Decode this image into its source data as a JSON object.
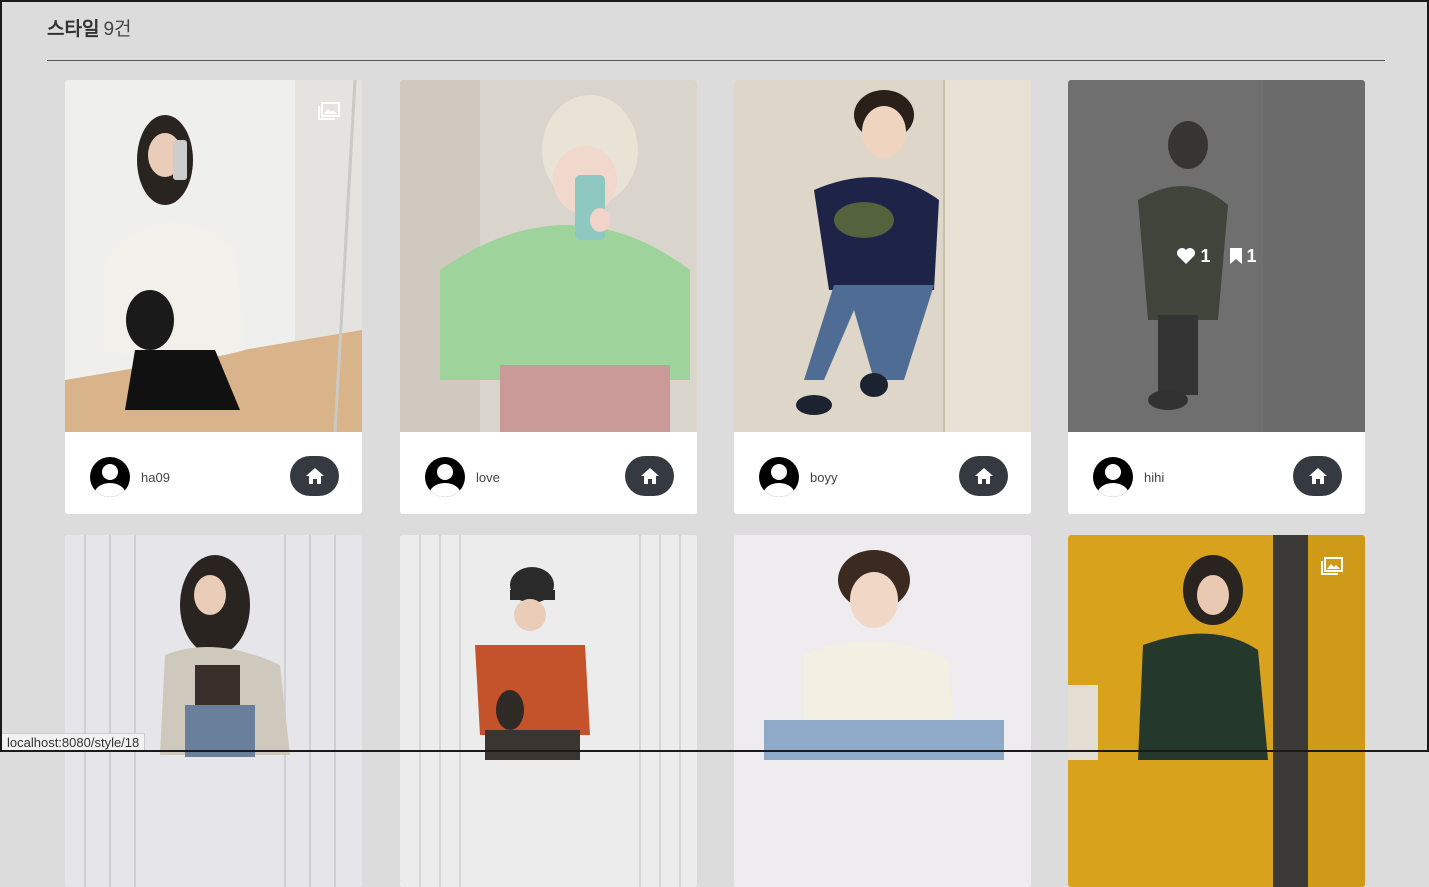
{
  "header": {
    "title": "스타일",
    "count": "9건"
  },
  "cards": [
    {
      "user": "ha09",
      "multi": true
    },
    {
      "user": "love",
      "multi": false
    },
    {
      "user": "boyy",
      "multi": false
    },
    {
      "user": "hihi",
      "multi": false,
      "hover": {
        "likes": "1",
        "bookmarks": "1"
      }
    },
    {
      "user": "",
      "multi": false
    },
    {
      "user": "",
      "multi": false
    },
    {
      "user": "",
      "multi": false
    },
    {
      "user": "",
      "multi": true
    }
  ],
  "status_url": "localhost:8080/style/18",
  "colors": {
    "background": "#dcdcdc",
    "button": "#343a40",
    "card": "#ffffff"
  }
}
